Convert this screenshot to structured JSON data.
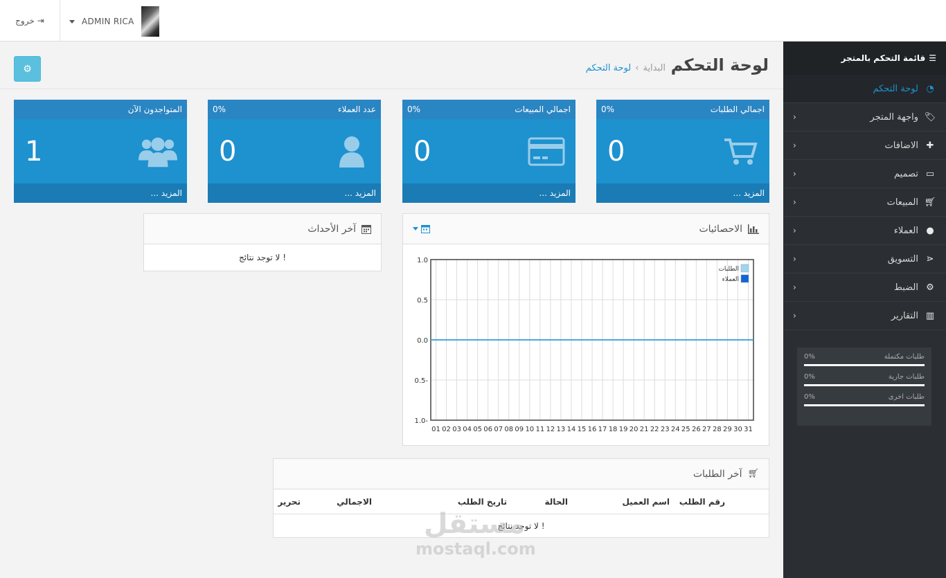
{
  "header": {
    "logout_label": "خروج",
    "user_name": "ADMIN RICA"
  },
  "sidebar": {
    "title": "قائمة التحكم بالمتجر",
    "items": [
      {
        "label": "لوحة التحكم",
        "icon": "dashboard-icon"
      },
      {
        "label": "واجهة المتجر",
        "icon": "tag-icon"
      },
      {
        "label": "الاضافات",
        "icon": "puzzle-icon"
      },
      {
        "label": "تصميم",
        "icon": "monitor-icon"
      },
      {
        "label": "المبيعات",
        "icon": "cart-icon"
      },
      {
        "label": "العملاء",
        "icon": "user-icon"
      },
      {
        "label": "التسويق",
        "icon": "share-icon"
      },
      {
        "label": "الضبط",
        "icon": "gear-icon"
      },
      {
        "label": "التقارير",
        "icon": "bar-chart-icon"
      }
    ],
    "progress": [
      {
        "label": "طلبات مكتملة",
        "value": "0%",
        "fraction": 1.0
      },
      {
        "label": "طلبات جارية",
        "value": "0%",
        "fraction": 1.0
      },
      {
        "label": "طلبات اخرى",
        "value": "0%",
        "fraction": 1.0
      }
    ]
  },
  "page": {
    "title": "لوحة التحكم",
    "breadcrumb_home": "البداية",
    "breadcrumb_current": "لوحة التحكم"
  },
  "tiles": [
    {
      "title": "اجمالي الطلبات",
      "percent": "0%",
      "value": "0",
      "more": "المزيد ...",
      "icon": "cart-icon"
    },
    {
      "title": "اجمالي المبيعات",
      "percent": "0%",
      "value": "0",
      "more": "المزيد ...",
      "icon": "credit-card-icon"
    },
    {
      "title": "عدد العملاء",
      "percent": "0%",
      "value": "0",
      "more": "المزيد ...",
      "icon": "user-icon"
    },
    {
      "title": "المتواجدون الآن",
      "percent": "",
      "value": "1",
      "more": "المزيد ...",
      "icon": "users-icon"
    }
  ],
  "events_panel": {
    "title": "آخر الأحداث",
    "empty": "لا توجد نتائج !"
  },
  "stats_panel": {
    "title": "الاحصائيات"
  },
  "orders_panel": {
    "title": "آخر الطلبات",
    "columns": [
      "رقم الطلب",
      "اسم العميل",
      "الحالة",
      "تاريخ الطلب",
      "الاجمالي",
      "تحرير"
    ],
    "empty": "لا توجد نتائج !"
  },
  "watermark": {
    "text_ar": "مستقل",
    "text_en": "mostaql.com"
  },
  "chart_data": {
    "type": "line",
    "x": [
      "01",
      "02",
      "03",
      "04",
      "05",
      "06",
      "07",
      "08",
      "09",
      "10",
      "11",
      "12",
      "13",
      "14",
      "15",
      "16",
      "17",
      "18",
      "19",
      "20",
      "21",
      "22",
      "23",
      "24",
      "25",
      "26",
      "27",
      "28",
      "29",
      "30",
      "31"
    ],
    "y_ticks": [
      "1.0",
      "0.5",
      "0.0",
      "0.5-",
      "1.0-"
    ],
    "ylim": [
      -1,
      1
    ],
    "series": [
      {
        "name": "الطلبات",
        "color": "#9fd5f1",
        "values": [
          0,
          0,
          0,
          0,
          0,
          0,
          0,
          0,
          0,
          0,
          0,
          0,
          0,
          0,
          0,
          0,
          0,
          0,
          0,
          0,
          0,
          0,
          0,
          0,
          0,
          0,
          0,
          0,
          0,
          0,
          0
        ]
      },
      {
        "name": "العملاء",
        "color": "#1065d6",
        "values": [
          0,
          0,
          0,
          0,
          0,
          0,
          0,
          0,
          0,
          0,
          0,
          0,
          0,
          0,
          0,
          0,
          0,
          0,
          0,
          0,
          0,
          0,
          0,
          0,
          0,
          0,
          0,
          0,
          0,
          0,
          0
        ]
      }
    ],
    "legend": "top-right"
  }
}
